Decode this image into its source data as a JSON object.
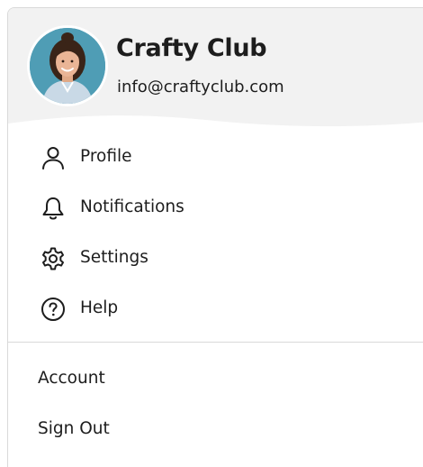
{
  "profile": {
    "name": "Crafty Club",
    "email": "info@craftyclub.com",
    "avatar": "user-avatar"
  },
  "menu": {
    "items": [
      {
        "label": "Profile",
        "icon": "person-icon"
      },
      {
        "label": "Notifications",
        "icon": "bell-icon"
      },
      {
        "label": "Settings",
        "icon": "gear-icon"
      },
      {
        "label": "Help",
        "icon": "question-circle-icon"
      }
    ],
    "secondary": [
      {
        "label": "Account"
      },
      {
        "label": "Sign Out"
      }
    ]
  },
  "colors": {
    "header_bg": "#f2f2f2",
    "text": "#1d1d1d",
    "divider": "#d9d9d9"
  }
}
